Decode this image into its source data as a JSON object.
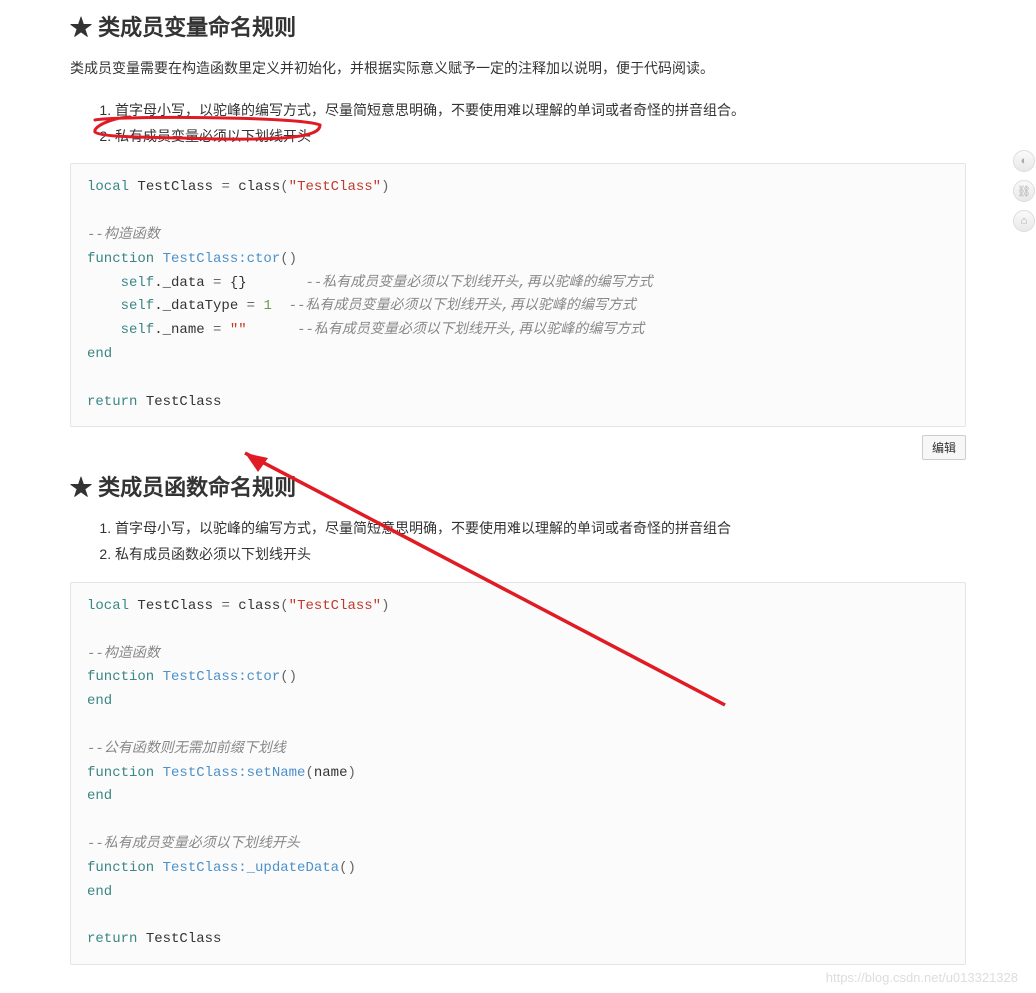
{
  "section1": {
    "title": "★ 类成员变量命名规则",
    "desc": "类成员变量需要在构造函数里定义并初始化，并根据实际意义赋予一定的注释加以说明，便于代码阅读。",
    "rules": [
      "首字母小写，以驼峰的编写方式，尽量简短意思明确，不要使用难以理解的单词或者奇怪的拼音组合。",
      "私有成员变量必须以下划线开头"
    ],
    "code": {
      "line1_local": "local",
      "line1_a": " TestClass ",
      "line1_eq": "=",
      "line1_b": " class",
      "line1_p1": "(",
      "line1_str": "\"TestClass\"",
      "line1_p2": ")",
      "line2": " ",
      "line3_c": "--构造函数",
      "line4_fn": "function",
      "line4_a": " TestClass:ctor",
      "line4_p": "()",
      "line5_a": "    self",
      "line5_b": "._data ",
      "line5_eq": "=",
      "line5_c": " {}       ",
      "line5_cm": "--私有成员变量必须以下划线开头,再以驼峰的编写方式",
      "line6_a": "    self",
      "line6_b": "._dataType ",
      "line6_eq": "=",
      "line6_c": " ",
      "line6_n": "1",
      "line6_d": "  ",
      "line6_cm": "--私有成员变量必须以下划线开头,再以驼峰的编写方式",
      "line7_a": "    self",
      "line7_b": "._name ",
      "line7_eq": "=",
      "line7_c": " ",
      "line7_str": "\"\"",
      "line7_d": "      ",
      "line7_cm": "--私有成员变量必须以下划线开头,再以驼峰的编写方式",
      "line8_end": "end",
      "line9": " ",
      "line10_ret": "return",
      "line10_b": " TestClass"
    }
  },
  "editLabel": "编辑",
  "section2": {
    "title": "★ 类成员函数命名规则",
    "rules": [
      "首字母小写，以驼峰的编写方式，尽量简短意思明确，不要使用难以理解的单词或者奇怪的拼音组合",
      "私有成员函数必须以下划线开头"
    ],
    "code": {
      "line1_local": "local",
      "line1_a": " TestClass ",
      "line1_eq": "=",
      "line1_b": " class",
      "line1_p1": "(",
      "line1_str": "\"TestClass\"",
      "line1_p2": ")",
      "line2": " ",
      "line3_c": "--构造函数",
      "line4_fn": "function",
      "line4_a": " TestClass:ctor",
      "line4_p": "()",
      "line5_end": "end",
      "line6": " ",
      "line7_c": "--公有函数则无需加前缀下划线",
      "line8_fn": "function",
      "line8_a": " TestClass:setName",
      "line8_p1": "(",
      "line8_arg": "name",
      "line8_p2": ")",
      "line9_end": "end",
      "line10": " ",
      "line11_c": "--私有成员变量必须以下划线开头",
      "line12_fn": "function",
      "line12_a": " TestClass:_updateData",
      "line12_p": "()",
      "line13_end": "end",
      "line14": " ",
      "line15_ret": "return",
      "line15_b": " TestClass"
    }
  },
  "watermark": "https://blog.csdn.net/u013321328"
}
